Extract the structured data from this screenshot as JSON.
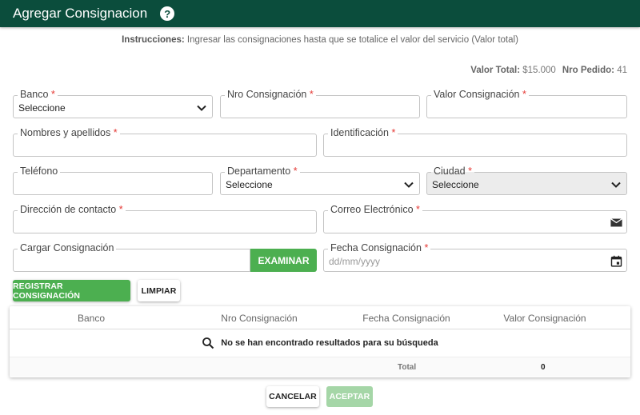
{
  "header": {
    "title": "Agregar Consignacion",
    "help_icon": "question-circle-icon"
  },
  "instructions": {
    "label": "Instrucciones:",
    "text": " Ingresar las consignaciones hasta que se totalice el valor del servicio (Valor total)"
  },
  "totals": {
    "valor_total_label": "Valor Total:",
    "valor_total": " $15.000",
    "nro_pedido_label": "Nro Pedido:",
    "nro_pedido": " 41"
  },
  "form": {
    "banco": {
      "label": "Banco",
      "value": "Seleccione"
    },
    "nro_consignacion": {
      "label": "Nro Consignación",
      "value": ""
    },
    "valor_consignacion": {
      "label": "Valor Consignación",
      "value": ""
    },
    "nombres": {
      "label": "Nombres y apellidos",
      "value": ""
    },
    "identificacion": {
      "label": "Identificación",
      "value": ""
    },
    "telefono": {
      "label": "Teléfono",
      "value": ""
    },
    "departamento": {
      "label": "Departamento",
      "value": "Seleccione"
    },
    "ciudad": {
      "label": "Ciudad",
      "value": "Seleccione"
    },
    "direccion": {
      "label": "Dirección de contacto",
      "value": ""
    },
    "correo": {
      "label": "Correo Electrónico",
      "value": "",
      "icon": "envelope-icon"
    },
    "cargar": {
      "label": "Cargar Consignación",
      "button": "EXAMINAR"
    },
    "fecha": {
      "label": "Fecha Consignación",
      "placeholder": "dd/mm/yyyy",
      "icon": "calendar-icon"
    },
    "required_mark": "*"
  },
  "actions": {
    "registrar": "REGISTRAR CONSIGNACIÓN",
    "limpiar": "LIMPIAR"
  },
  "table": {
    "columns": [
      "Banco",
      "Nro Consignación",
      "Fecha Consignación",
      "Valor Consignación"
    ],
    "empty_message": "No se han encontrado resultados para su búsqueda",
    "total_label": "Total",
    "total_value": "0"
  },
  "footer": {
    "cancelar": "CANCELAR",
    "aceptar": "ACEPTAR"
  },
  "colors": {
    "header": "#0b4d3c",
    "accent": "#4caf50",
    "required": "#e53935"
  }
}
